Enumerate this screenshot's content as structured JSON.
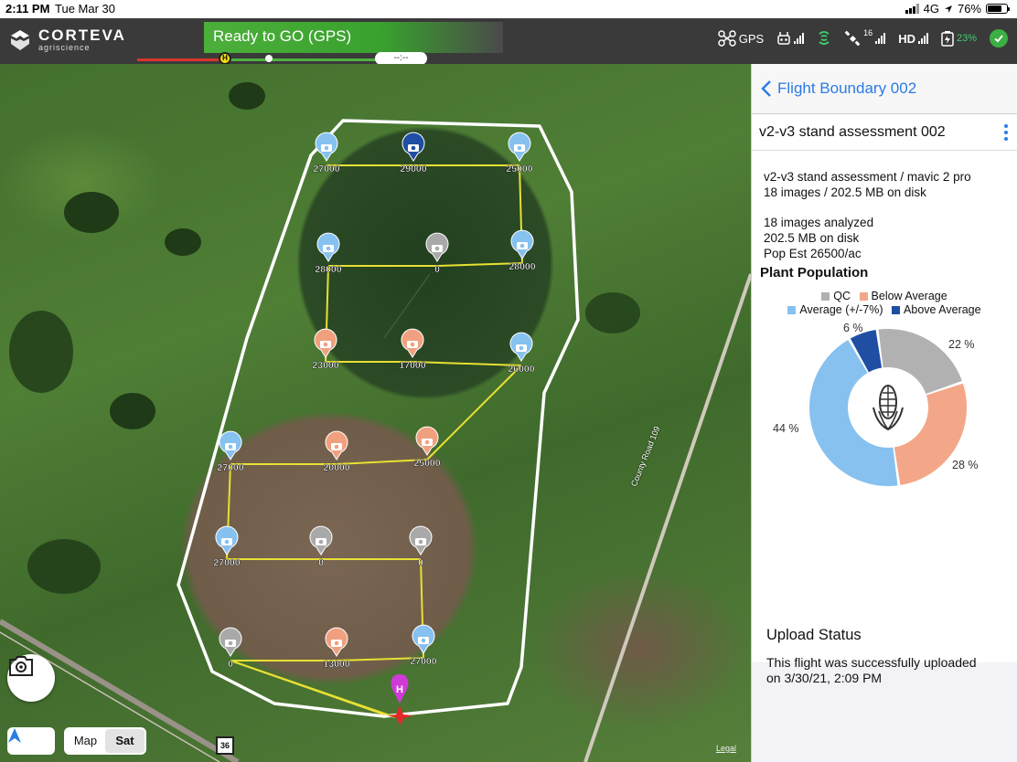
{
  "status_bar": {
    "time": "2:11 PM",
    "date": "Tue Mar 30",
    "network": "4G",
    "battery": "76%"
  },
  "app_bar": {
    "brand": "CORTEVA",
    "brand_sub": "agriscience",
    "ready_text": "Ready to GO (GPS)",
    "home_marker": "H",
    "eta": "--:--",
    "telemetry": {
      "gps": "GPS",
      "hd": "HD",
      "sat_count": "16",
      "battery_pct": "23%"
    }
  },
  "map": {
    "map_type": {
      "map_label": "Map",
      "sat_label": "Sat",
      "selected": "Sat"
    },
    "road_sign": "36",
    "road_label": "County Road 109",
    "legal": "Legal",
    "home_pin": "H",
    "colors": {
      "qc": "#a9a9a9",
      "below": "#f0a07f",
      "average": "#86c1f0",
      "above": "#1f4ea3",
      "route": "#e8e033",
      "boundary": "#ffffff"
    },
    "waypoints": [
      {
        "value": "27000",
        "cat": "average"
      },
      {
        "value": "29000",
        "cat": "above"
      },
      {
        "value": "25000",
        "cat": "average"
      },
      {
        "value": "28000",
        "cat": "average"
      },
      {
        "value": "0",
        "cat": "qc"
      },
      {
        "value": "28000",
        "cat": "average"
      },
      {
        "value": "23000",
        "cat": "below"
      },
      {
        "value": "17000",
        "cat": "below"
      },
      {
        "value": "26000",
        "cat": "average"
      },
      {
        "value": "27000",
        "cat": "average"
      },
      {
        "value": "20000",
        "cat": "below"
      },
      {
        "value": "25000",
        "cat": "below"
      },
      {
        "value": "27000",
        "cat": "average"
      },
      {
        "value": "0",
        "cat": "qc"
      },
      {
        "value": "0",
        "cat": "qc"
      },
      {
        "value": "0",
        "cat": "qc"
      },
      {
        "value": "13000",
        "cat": "below"
      },
      {
        "value": "27000",
        "cat": "average"
      }
    ]
  },
  "panel": {
    "back_label": "Flight Boundary 002",
    "title": "v2-v3 stand assessment 002",
    "summary_line1": "v2-v3 stand assessment / mavic 2 pro",
    "summary_line2": "18 images / 202.5 MB on disk",
    "analyzed_line1": "18 images analyzed",
    "analyzed_line2": "202.5 MB on disk",
    "analyzed_line3": "Pop Est 26500/ac",
    "plant_population_title": "Plant Population",
    "legend": {
      "qc": "QC",
      "below": "Below Average",
      "average": "Average (+/-7%)",
      "above": "Above Average"
    },
    "upload_title": "Upload Status",
    "upload_line1": "This flight was successfully uploaded",
    "upload_line2": "on 3/30/21, 2:09 PM"
  },
  "chart_data": {
    "type": "pie",
    "style": "donut",
    "categories": [
      "QC",
      "Below Average",
      "Average (+/-7%)",
      "Above Average"
    ],
    "values": [
      22,
      28,
      44,
      6
    ],
    "labels": [
      "22 %",
      "28 %",
      "44 %",
      "6 %"
    ],
    "colors": [
      "#b1b1b1",
      "#f4a788",
      "#86c1f0",
      "#1f4ea3"
    ],
    "title": "Plant Population",
    "legend_position": "top"
  }
}
